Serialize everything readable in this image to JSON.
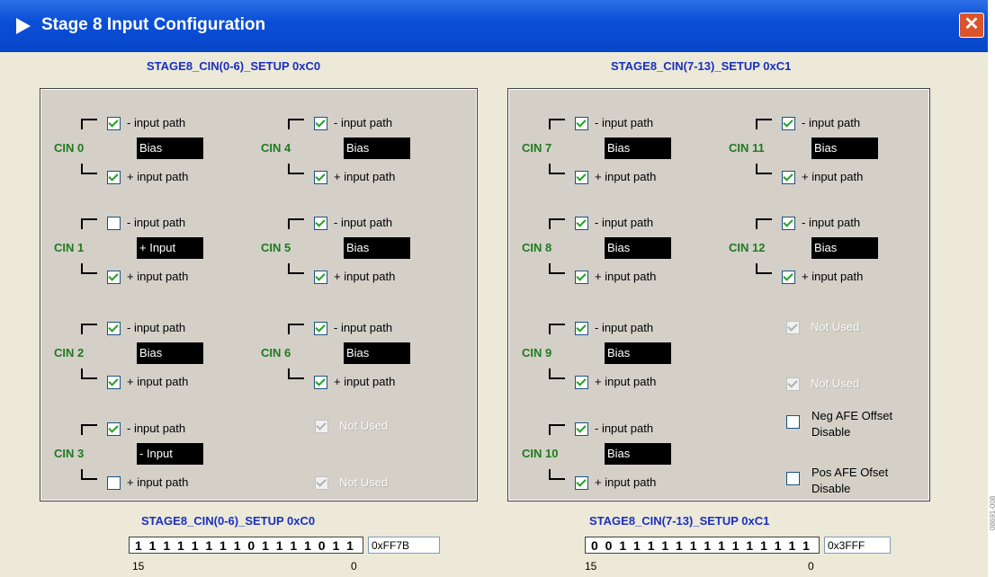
{
  "window": {
    "title": "Stage 8 Input Configuration",
    "close_label": "✕"
  },
  "groups": [
    {
      "title": "STAGE8_CIN(0-6)_SETUP 0xC0"
    },
    {
      "title": "STAGE8_CIN(7-13)_SETUP 0xC1"
    }
  ],
  "cins": [
    {
      "name": "CIN 0",
      "neg_label": "- input path",
      "neg_checked": true,
      "bias": "Bias",
      "pos_label": "+ input path",
      "pos_checked": true
    },
    {
      "name": "CIN 1",
      "neg_label": "- input path",
      "neg_checked": false,
      "bias": "+ Input",
      "pos_label": "+ input path",
      "pos_checked": true
    },
    {
      "name": "CIN 2",
      "neg_label": "- input path",
      "neg_checked": true,
      "bias": "Bias",
      "pos_label": "+ input path",
      "pos_checked": true
    },
    {
      "name": "CIN 3",
      "neg_label": "- input path",
      "neg_checked": true,
      "bias": "- Input",
      "pos_label": "+ input path",
      "pos_checked": false
    },
    {
      "name": "CIN 4",
      "neg_label": "- input path",
      "neg_checked": true,
      "bias": "Bias",
      "pos_label": "+ input path",
      "pos_checked": true
    },
    {
      "name": "CIN 5",
      "neg_label": "- input path",
      "neg_checked": true,
      "bias": "Bias",
      "pos_label": "+ input path",
      "pos_checked": true
    },
    {
      "name": "CIN 6",
      "neg_label": "- input path",
      "neg_checked": true,
      "bias": "Bias",
      "pos_label": "+ input path",
      "pos_checked": true
    },
    {
      "name": "CIN 7",
      "neg_label": "- input path",
      "neg_checked": true,
      "bias": "Bias",
      "pos_label": "+ input path",
      "pos_checked": true
    },
    {
      "name": "CIN 8",
      "neg_label": "- input path",
      "neg_checked": true,
      "bias": "Bias",
      "pos_label": "+ input path",
      "pos_checked": true
    },
    {
      "name": "CIN 9",
      "neg_label": "- input path",
      "neg_checked": true,
      "bias": "Bias",
      "pos_label": "+ input path",
      "pos_checked": true
    },
    {
      "name": "CIN 10",
      "neg_label": "- input path",
      "neg_checked": true,
      "bias": "Bias",
      "pos_label": "+ input path",
      "pos_checked": true
    },
    {
      "name": "CIN 11",
      "neg_label": "- input path",
      "neg_checked": true,
      "bias": "Bias",
      "pos_label": "+ input path",
      "pos_checked": true
    },
    {
      "name": "CIN 12",
      "neg_label": "- input path",
      "neg_checked": true,
      "bias": "Bias",
      "pos_label": "+ input path",
      "pos_checked": true
    }
  ],
  "not_used_label": "Not Used",
  "extra": {
    "neg_afe": "Neg AFE Offset\nDisable",
    "neg_afe_line1": "Neg AFE Offset",
    "neg_afe_line2": "Disable",
    "pos_afe_line1": "Pos AFE Ofset",
    "pos_afe_line2": "Disable",
    "neg_afe_checked": false,
    "pos_afe_checked": false
  },
  "registers": [
    {
      "title": "STAGE8_CIN(0-6)_SETUP 0xC0",
      "bits": "1111111101111011",
      "hex": "0xFF7B",
      "msb": "15",
      "lsb": "0"
    },
    {
      "title": "STAGE8_CIN(7-13)_SETUP 0xC1",
      "bits": "0011111111111111",
      "hex": "0x3FFF",
      "msb": "15",
      "lsb": "0"
    }
  ],
  "figure_id": "08691-008",
  "colors": {
    "titlebar": "#0a4fd8",
    "cin_label": "#1f7a1f",
    "group_title": "#1a2fc0",
    "panel": "#d4d0c8"
  }
}
